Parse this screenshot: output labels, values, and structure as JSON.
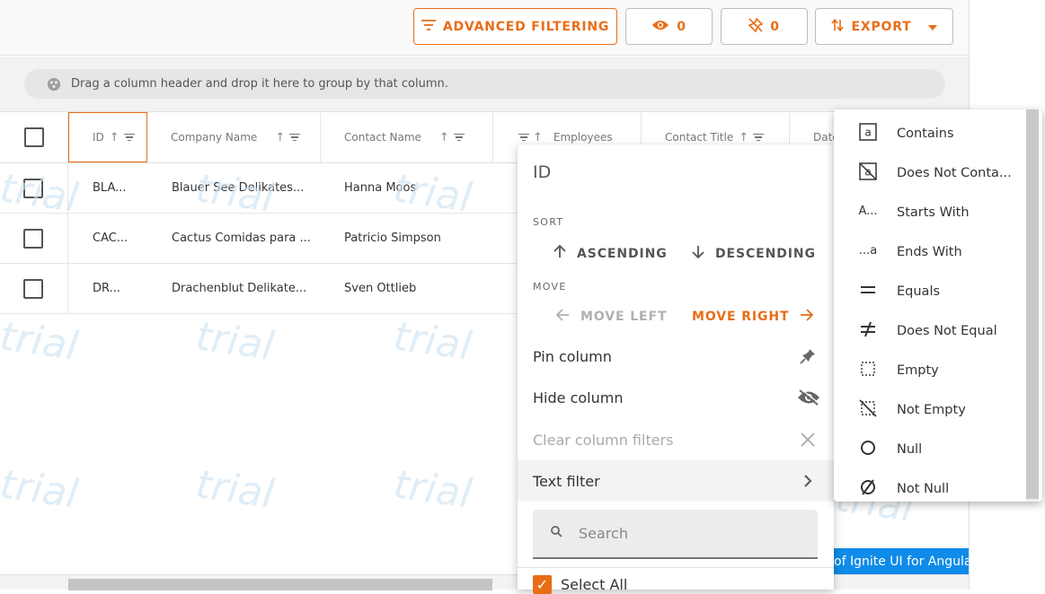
{
  "toolbar": {
    "advanced_filtering": "ADVANCED FILTERING",
    "hidden_count": "0",
    "pinned_count": "0",
    "export": "EXPORT"
  },
  "group_area": {
    "hint": "Drag a column header and drop it here to group by that column."
  },
  "columns": [
    {
      "label": "ID"
    },
    {
      "label": "Company Name"
    },
    {
      "label": "Contact Name"
    },
    {
      "label": "Employees"
    },
    {
      "label": "Contact Title"
    },
    {
      "label": "Date"
    }
  ],
  "rows": [
    {
      "id": "BLA...",
      "company": "Blauer See Delikates...",
      "contact": "Hanna Moos"
    },
    {
      "id": "CAC...",
      "company": "Cactus Comidas para ...",
      "contact": "Patricio Simpson"
    },
    {
      "id": "DR...",
      "company": "Drachenblut Delikate...",
      "contact": "Sven Ottlieb"
    }
  ],
  "watermark_text": "trial",
  "ribbon": {
    "text": "of Ignite UI for Angular"
  },
  "column_menu": {
    "title": "ID",
    "sort_label": "SORT",
    "ascending": "ASCENDING",
    "descending": "DESCENDING",
    "move_label": "MOVE",
    "move_left": "MOVE LEFT",
    "move_right": "MOVE RIGHT",
    "pin": "Pin column",
    "hide": "Hide column",
    "clear": "Clear column filters",
    "text_filter": "Text filter",
    "search_placeholder": "Search",
    "select_all": "Select All"
  },
  "filter_conditions": [
    {
      "label": "Contains",
      "icon": "contains-icon"
    },
    {
      "label": "Does Not Conta...",
      "icon": "does-not-contain-icon"
    },
    {
      "label": "Starts With",
      "icon": "starts-with-icon"
    },
    {
      "label": "Ends With",
      "icon": "ends-with-icon"
    },
    {
      "label": "Equals",
      "icon": "equals-icon"
    },
    {
      "label": "Does Not Equal",
      "icon": "not-equal-icon"
    },
    {
      "label": "Empty",
      "icon": "empty-icon"
    },
    {
      "label": "Not Empty",
      "icon": "not-empty-icon"
    },
    {
      "label": "Null",
      "icon": "null-icon"
    },
    {
      "label": "Not Null",
      "icon": "not-null-icon"
    }
  ],
  "colors": {
    "accent": "#e96d16",
    "ribbon": "#0f8be9",
    "watermark": "#cfe4f3"
  }
}
